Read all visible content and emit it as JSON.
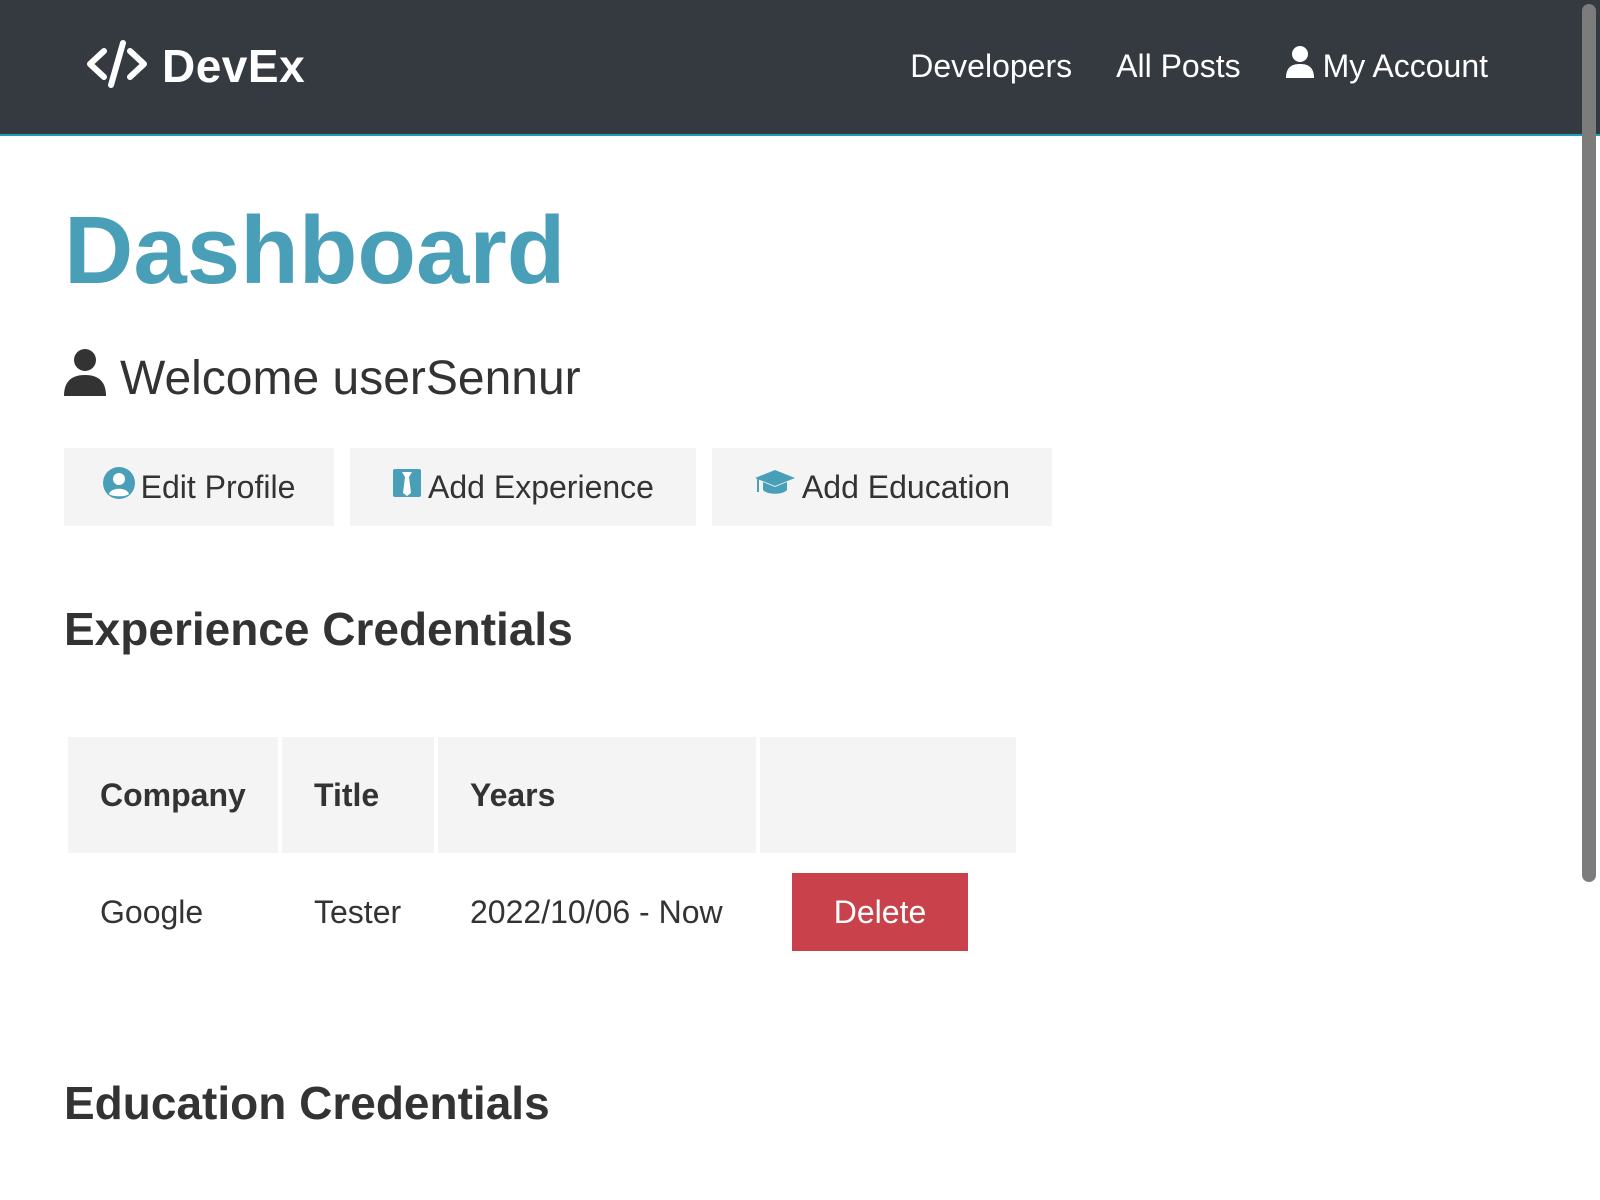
{
  "navbar": {
    "brand": "DevEx",
    "links": [
      "Developers",
      "All Posts",
      "My Account"
    ]
  },
  "page": {
    "title": "Dashboard",
    "welcome": "Welcome userSennur"
  },
  "actions": {
    "edit_profile": "Edit Profile",
    "add_experience": "Add Experience",
    "add_education": "Add Education"
  },
  "experience": {
    "heading": "Experience Credentials",
    "columns": [
      "Company",
      "Title",
      "Years",
      ""
    ],
    "rows": [
      {
        "company": "Google",
        "title": "Tester",
        "years": "2022/10/06 - Now",
        "action": "Delete"
      }
    ]
  },
  "education": {
    "heading": "Education Credentials"
  },
  "colors": {
    "navbar_bg": "#343a40",
    "accent": "#4a9fb8",
    "danger": "#c9424b",
    "light_bg": "#f4f4f4"
  },
  "icons": [
    "code-icon",
    "user-icon",
    "user-circle-icon",
    "id-badge-icon",
    "graduation-cap-icon"
  ]
}
